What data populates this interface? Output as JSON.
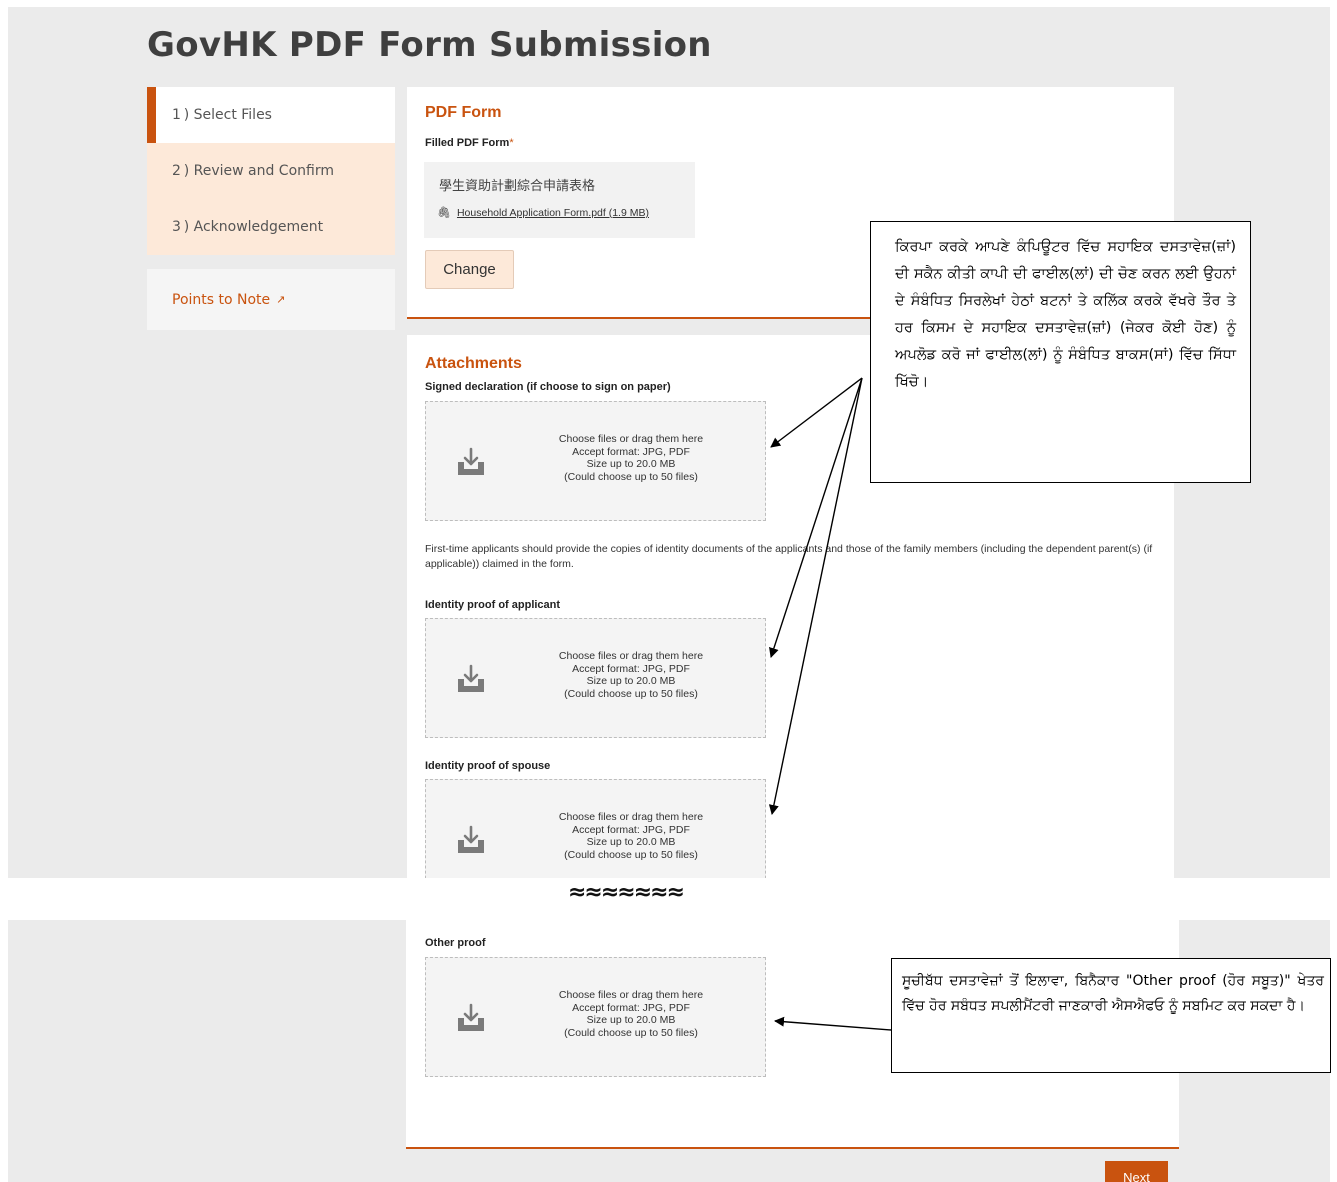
{
  "page_title": "GovHK PDF Form Submission",
  "steps": [
    {
      "label": "1 ) Select Files",
      "active": true
    },
    {
      "label": "2 ) Review and Confirm",
      "active": false
    },
    {
      "label": "3 ) Acknowledgement",
      "active": false
    }
  ],
  "points_to_note": {
    "label": "Points to Note",
    "icon": "external-link-icon"
  },
  "pdf_form": {
    "title": "PDF Form",
    "field_label": "Filled PDF Form",
    "required_mark": "*",
    "file_title": "學生資助計劃綜合申請表格",
    "file_link": "Household Application Form.pdf (1.9 MB)",
    "change_button": "Change"
  },
  "attachments": {
    "title": "Attachments",
    "signed_declaration_label": "Signed declaration (if choose to sign on paper)",
    "note": "First-time applicants should provide the copies of identity documents of the applicants and those of the family members (including the dependent parent(s) (if applicable)) claimed in the form.",
    "identity_applicant_label": "Identity proof of applicant",
    "identity_spouse_label": "Identity proof of spouse",
    "other_proof_label": "Other proof",
    "dropzone": {
      "line1": "Choose files or drag them here",
      "line2": "Accept format: JPG, PDF",
      "line3": "Size up to 20.0 MB",
      "line4": "(Could choose up to 50 files)"
    }
  },
  "separator": "≈≈≈≈≈≈≈",
  "next_button": "Next",
  "callouts": {
    "upload_instruction": "ਕਿਰਪਾ ਕਰਕੇ ਆਪਣੇ ਕੰਪਿਊਟਰ ਵਿੱਚ ਸਹਾਇਕ ਦਸਤਾਵੇਜ਼(ਜ਼ਾਂ) ਦੀ ਸਕੈਨ ਕੀਤੀ ਕਾਪੀ ਦੀ ਫਾਈਲ(ਲਾਂ) ਦੀ ਚੋਣ ਕਰਨ ਲਈ ਉਹਨਾਂ ਦੇ ਸੰਬੰਧਿਤ ਸਿਰਲੇਖਾਂ ਹੇਠਾਂ ਬਟਨਾਂ ਤੇ ਕਲਿੱਕ ਕਰਕੇ ਵੱਖਰੇ ਤੌਰ ਤੇ ਹਰ ਕਿਸਮ ਦੇ ਸਹਾਇਕ ਦਸਤਾਵੇਜ਼(ਜ਼ਾਂ) (ਜੇਕਰ ਕੋਈ ਹੋਣ) ਨੂੰ ਅਪਲੋਡ ਕਰੋ ਜਾਂ ਫਾਈਲ(ਲਾਂ) ਨੂੰ ਸੰਬੰਧਿਤ ਬਾਕਸ(ਸਾਂ) ਵਿੱਚ ਸਿੱਧਾ ਖਿੱਚੋ।",
    "other_proof_note": "ਸੂਚੀਬੱਧ ਦਸਤਾਵੇਜ਼ਾਂ ਤੋਂ ਇਲਾਵਾ, ਬਿਨੈਕਾਰ \"Other proof (ਹੋਰ ਸਬੂਤ)\" ਖੇਤਰ ਵਿੱਚ ਹੋਰ ਸਬੰਧਤ ਸਪਲੀਮੈਂਟਰੀ ਜਾਣਕਾਰੀ ਐਸਐਫਓ ਨੂੰ ਸਬਮਿਟ ਕਰ ਸਕਦਾ ਹੈ।"
  },
  "colors": {
    "accent": "#c9530f",
    "step_bg": "#fde9d9",
    "page_bg": "#ebebeb"
  }
}
